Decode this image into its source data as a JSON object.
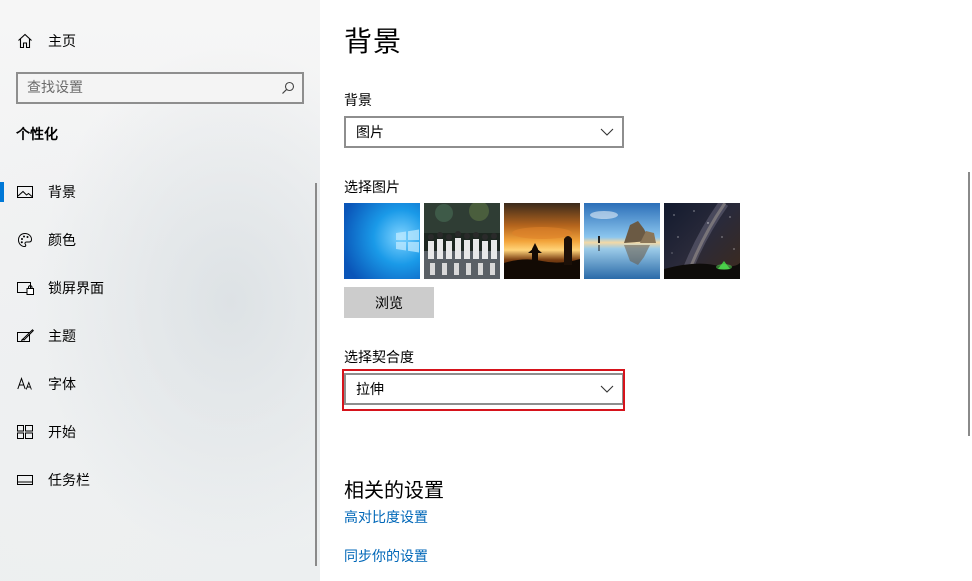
{
  "sidebar": {
    "home_label": "主页",
    "search_placeholder": "查找设置",
    "section_title": "个性化",
    "items": [
      {
        "label": "背景",
        "icon": "image-icon",
        "active": true
      },
      {
        "label": "颜色",
        "icon": "palette-icon",
        "active": false
      },
      {
        "label": "锁屏界面",
        "icon": "lock-screen-icon",
        "active": false
      },
      {
        "label": "主题",
        "icon": "theme-brush-icon",
        "active": false
      },
      {
        "label": "字体",
        "icon": "font-icon",
        "active": false
      },
      {
        "label": "开始",
        "icon": "start-tiles-icon",
        "active": false
      },
      {
        "label": "任务栏",
        "icon": "taskbar-icon",
        "active": false
      }
    ]
  },
  "main": {
    "title": "背景",
    "background_label": "背景",
    "background_value": "图片",
    "choose_picture_label": "选择图片",
    "pictures": [
      {
        "name": "windows-blue"
      },
      {
        "name": "group-photo-night"
      },
      {
        "name": "sunset-pagoda"
      },
      {
        "name": "sea-rocks-reflection"
      },
      {
        "name": "milky-way-night"
      }
    ],
    "browse_label": "浏览",
    "fit_label": "选择契合度",
    "fit_value": "拉伸",
    "related_title": "相关的设置",
    "links": [
      "高对比度设置",
      "同步你的设置"
    ]
  },
  "colors": {
    "accent": "#0078d7",
    "link": "#0067b8",
    "highlight_border": "#d6131b"
  }
}
